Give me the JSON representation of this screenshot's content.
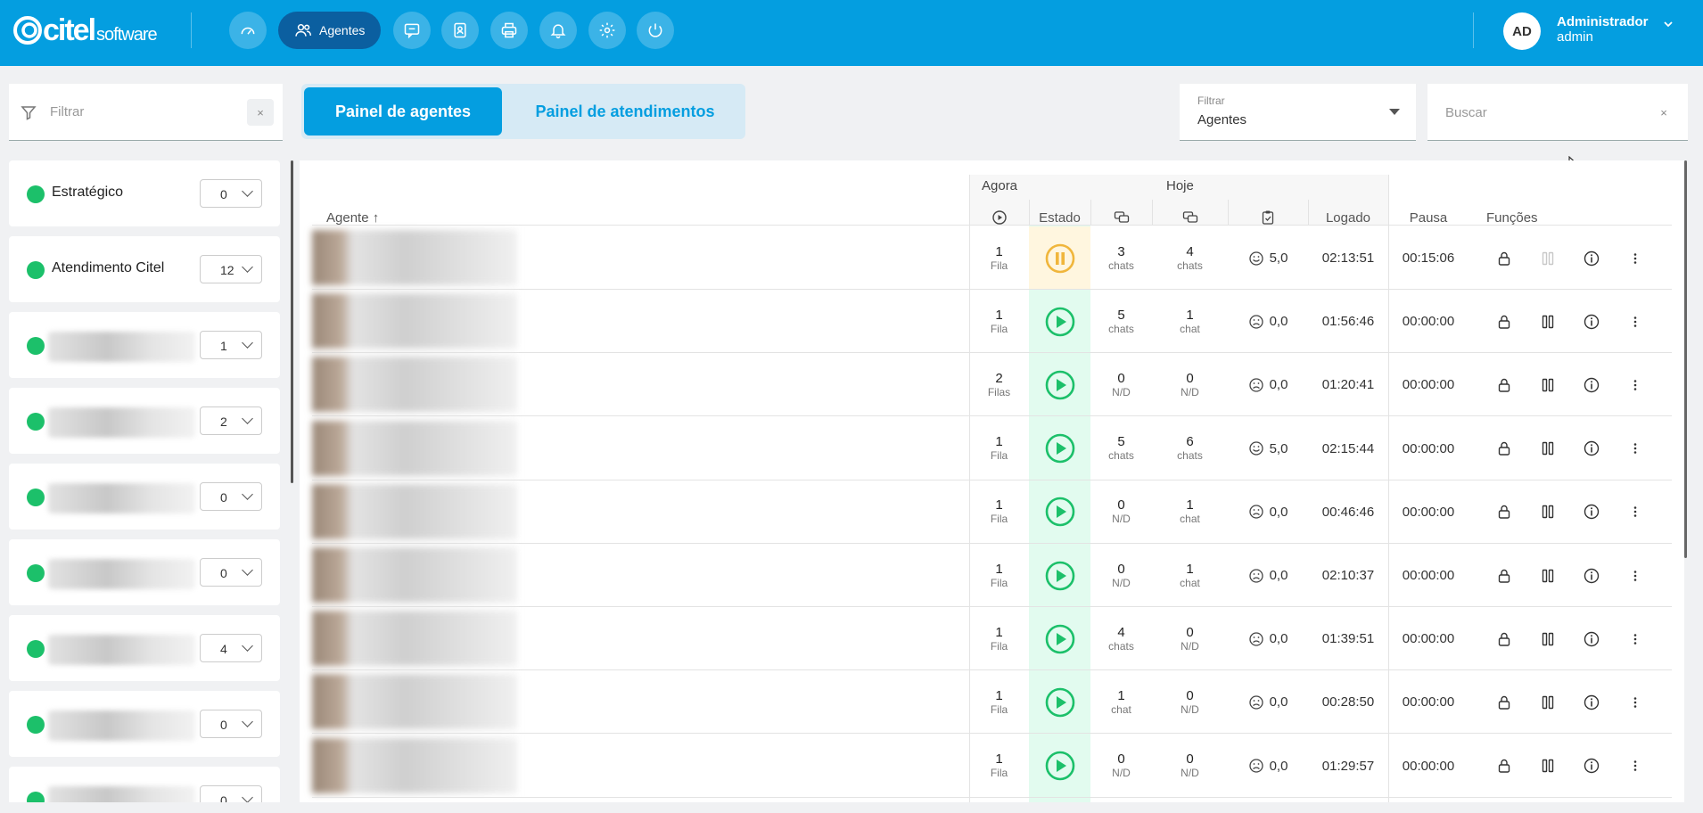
{
  "topbar": {
    "logo_brand": "citel",
    "logo_sub": "software",
    "nav_active_label": "Agentes",
    "nav_icons": [
      "dashboard-icon",
      "agents-icon",
      "chat-icon",
      "contacts-icon",
      "print-icon",
      "bell-icon",
      "gear-icon",
      "power-icon"
    ],
    "user_initials": "AD",
    "user_name": "Administrador",
    "user_role": "admin"
  },
  "left_filter": {
    "placeholder": "Filtrar",
    "clear": "×"
  },
  "tabs": {
    "agents": "Painel de agentes",
    "attendances": "Painel de atendimentos"
  },
  "filter_select": {
    "label": "Filtrar",
    "value": "Agentes"
  },
  "search": {
    "placeholder": "Buscar",
    "clear": "×"
  },
  "queues": [
    {
      "name": "Estratégico",
      "count": "0"
    },
    {
      "name": "Atendimento Citel",
      "count": "12"
    },
    {
      "name": "",
      "count": "1"
    },
    {
      "name": "",
      "count": "2"
    },
    {
      "name": "",
      "count": "0"
    },
    {
      "name": "",
      "count": "0"
    },
    {
      "name": "",
      "count": "4"
    },
    {
      "name": "",
      "count": "0"
    },
    {
      "name": "",
      "count": "0"
    }
  ],
  "table": {
    "group_now": "Agora",
    "group_today": "Hoje",
    "col_agent": "Agente ↑",
    "col_state": "Estado",
    "col_logged": "Logado",
    "col_pause": "Pausa",
    "col_functions": "Funções",
    "rows": [
      {
        "queues_n": "1",
        "queues_u": "Fila",
        "state": "paused",
        "now_n": "3",
        "now_u": "chats",
        "today_n": "4",
        "today_u": "chats",
        "rating": "5,0",
        "mood": "happy",
        "logged": "02:13:51",
        "pause": "00:15:06",
        "pause_disabled": true
      },
      {
        "queues_n": "1",
        "queues_u": "Fila",
        "state": "active",
        "now_n": "5",
        "now_u": "chats",
        "today_n": "1",
        "today_u": "chat",
        "rating": "0,0",
        "mood": "sad",
        "logged": "01:56:46",
        "pause": "00:00:00",
        "pause_disabled": false
      },
      {
        "queues_n": "2",
        "queues_u": "Filas",
        "state": "active",
        "now_n": "0",
        "now_u": "N/D",
        "today_n": "0",
        "today_u": "N/D",
        "rating": "0,0",
        "mood": "sad",
        "logged": "01:20:41",
        "pause": "00:00:00",
        "pause_disabled": false
      },
      {
        "queues_n": "1",
        "queues_u": "Fila",
        "state": "active",
        "now_n": "5",
        "now_u": "chats",
        "today_n": "6",
        "today_u": "chats",
        "rating": "5,0",
        "mood": "happy",
        "logged": "02:15:44",
        "pause": "00:00:00",
        "pause_disabled": false
      },
      {
        "queues_n": "1",
        "queues_u": "Fila",
        "state": "active",
        "now_n": "0",
        "now_u": "N/D",
        "today_n": "1",
        "today_u": "chat",
        "rating": "0,0",
        "mood": "sad",
        "logged": "00:46:46",
        "pause": "00:00:00",
        "pause_disabled": false
      },
      {
        "queues_n": "1",
        "queues_u": "Fila",
        "state": "active",
        "now_n": "0",
        "now_u": "N/D",
        "today_n": "1",
        "today_u": "chat",
        "rating": "0,0",
        "mood": "sad",
        "logged": "02:10:37",
        "pause": "00:00:00",
        "pause_disabled": false
      },
      {
        "queues_n": "1",
        "queues_u": "Fila",
        "state": "active",
        "now_n": "4",
        "now_u": "chats",
        "today_n": "0",
        "today_u": "N/D",
        "rating": "0,0",
        "mood": "sad",
        "logged": "01:39:51",
        "pause": "00:00:00",
        "pause_disabled": false
      },
      {
        "queues_n": "1",
        "queues_u": "Fila",
        "state": "active",
        "now_n": "1",
        "now_u": "chat",
        "today_n": "0",
        "today_u": "N/D",
        "rating": "0,0",
        "mood": "sad",
        "logged": "00:28:50",
        "pause": "00:00:00",
        "pause_disabled": false
      },
      {
        "queues_n": "1",
        "queues_u": "Fila",
        "state": "active",
        "now_n": "0",
        "now_u": "N/D",
        "today_n": "0",
        "today_u": "N/D",
        "rating": "0,0",
        "mood": "sad",
        "logged": "01:29:57",
        "pause": "00:00:00",
        "pause_disabled": false
      }
    ]
  },
  "colors": {
    "topbar": "#049ee0",
    "nav_active": "#0b5fa0",
    "online": "#1cc06a",
    "active_state": "#1cc06a",
    "paused_state": "#f0b63c"
  }
}
